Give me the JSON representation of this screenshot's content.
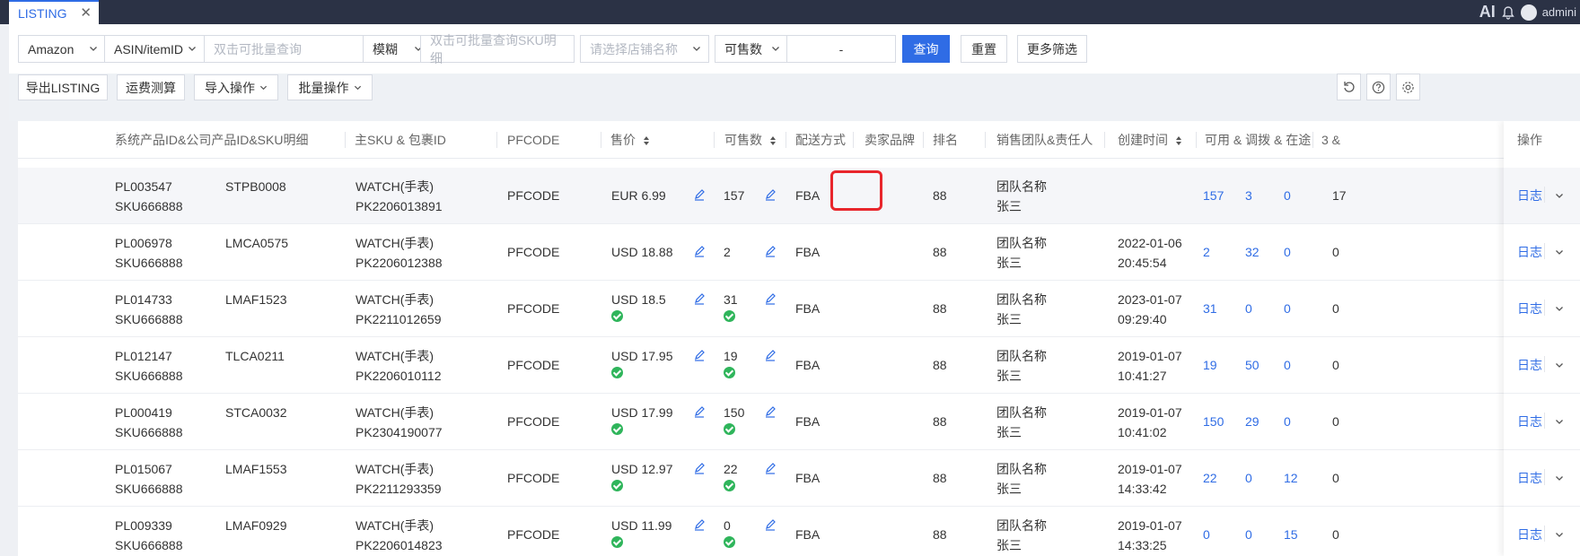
{
  "tab": {
    "label": "LISTING",
    "close": "✕"
  },
  "header": {
    "ai": "AI",
    "user": "admini"
  },
  "filters": {
    "platform": "Amazon",
    "id_type": "ASIN/itemID",
    "id_placeholder": "双击可批量查询",
    "match": "模糊",
    "sku_placeholder": "双击可批量查询SKU明细",
    "shop_placeholder": "请选择店铺名称",
    "qty_type": "可售数",
    "range_sep": "-",
    "search": "查询",
    "reset": "重置",
    "more": "更多筛选"
  },
  "actions": {
    "export": "导出LISTING",
    "freight": "运费测算",
    "import": "导入操作",
    "batch": "批量操作"
  },
  "columns": {
    "product": "系统产品ID&公司产品ID&SKU明细",
    "main_sku": "主SKU & 包裹ID",
    "pfcode": "PFCODE",
    "price": "售价",
    "sellable": "可售数",
    "delivery": "配送方式",
    "brand": "卖家品牌",
    "rank": "排名",
    "team": "销售团队&责任人",
    "created": "创建时间",
    "stock": "可用 & 调拨 & 在途",
    "extra": "3 &",
    "ops": "操作"
  },
  "rows": [
    {
      "pl": "PL003547",
      "sku": "SKU666888",
      "code": "STPB0008",
      "msku": "WATCH(手表)",
      "pk": "PK2206013891",
      "pf": "PFCODE",
      "price": "EUR 6.99",
      "price_ok": false,
      "qty": "157",
      "qty_ok": false,
      "ship": "FBA",
      "rank": "88",
      "team": "团队名称",
      "owner": "张三",
      "date": "",
      "time": "",
      "a": "157",
      "b": "3",
      "c": "0",
      "d": "17",
      "log": "日志"
    },
    {
      "pl": "PL006978",
      "sku": "SKU666888",
      "code": "LMCA0575",
      "msku": "WATCH(手表)",
      "pk": "PK2206012388",
      "pf": "PFCODE",
      "price": "USD 18.88",
      "price_ok": false,
      "qty": "2",
      "qty_ok": false,
      "ship": "FBA",
      "rank": "88",
      "team": "团队名称",
      "owner": "张三",
      "date": "2022-01-06",
      "time": "20:45:54",
      "a": "2",
      "b": "32",
      "c": "0",
      "d": "0",
      "log": "日志"
    },
    {
      "pl": "PL014733",
      "sku": "SKU666888",
      "code": "LMAF1523",
      "msku": "WATCH(手表)",
      "pk": "PK2211012659",
      "pf": "PFCODE",
      "price": "USD 18.5",
      "price_ok": true,
      "qty": "31",
      "qty_ok": true,
      "ship": "FBA",
      "rank": "88",
      "team": "团队名称",
      "owner": "张三",
      "date": "2023-01-07",
      "time": "09:29:40",
      "a": "31",
      "b": "0",
      "c": "0",
      "d": "0",
      "log": "日志"
    },
    {
      "pl": "PL012147",
      "sku": "SKU666888",
      "code": "TLCA0211",
      "msku": "WATCH(手表)",
      "pk": "PK2206010112",
      "pf": "PFCODE",
      "price": "USD 17.95",
      "price_ok": true,
      "qty": "19",
      "qty_ok": true,
      "ship": "FBA",
      "rank": "88",
      "team": "团队名称",
      "owner": "张三",
      "date": "2019-01-07",
      "time": "10:41:27",
      "a": "19",
      "b": "50",
      "c": "0",
      "d": "0",
      "log": "日志"
    },
    {
      "pl": "PL000419",
      "sku": "SKU666888",
      "code": "STCA0032",
      "msku": "WATCH(手表)",
      "pk": "PK2304190077",
      "pf": "PFCODE",
      "price": "USD 17.99",
      "price_ok": true,
      "qty": "150",
      "qty_ok": true,
      "ship": "FBA",
      "rank": "88",
      "team": "团队名称",
      "owner": "张三",
      "date": "2019-01-07",
      "time": "10:41:02",
      "a": "150",
      "b": "29",
      "c": "0",
      "d": "0",
      "log": "日志"
    },
    {
      "pl": "PL015067",
      "sku": "SKU666888",
      "code": "LMAF1553",
      "msku": "WATCH(手表)",
      "pk": "PK2211293359",
      "pf": "PFCODE",
      "price": "USD 12.97",
      "price_ok": true,
      "qty": "22",
      "qty_ok": true,
      "ship": "FBA",
      "rank": "88",
      "team": "团队名称",
      "owner": "张三",
      "date": "2019-01-07",
      "time": "14:33:42",
      "a": "22",
      "b": "0",
      "c": "12",
      "d": "0",
      "log": "日志"
    },
    {
      "pl": "PL009339",
      "sku": "SKU666888",
      "code": "LMAF0929",
      "msku": "WATCH(手表)",
      "pk": "PK2206014823",
      "pf": "PFCODE",
      "price": "USD 11.99",
      "price_ok": true,
      "qty": "0",
      "qty_ok": true,
      "ship": "FBA",
      "rank": "88",
      "team": "团队名称",
      "owner": "张三",
      "date": "2019-01-07",
      "time": "14:33:25",
      "a": "0",
      "b": "0",
      "c": "15",
      "d": "0",
      "log": "日志"
    }
  ]
}
